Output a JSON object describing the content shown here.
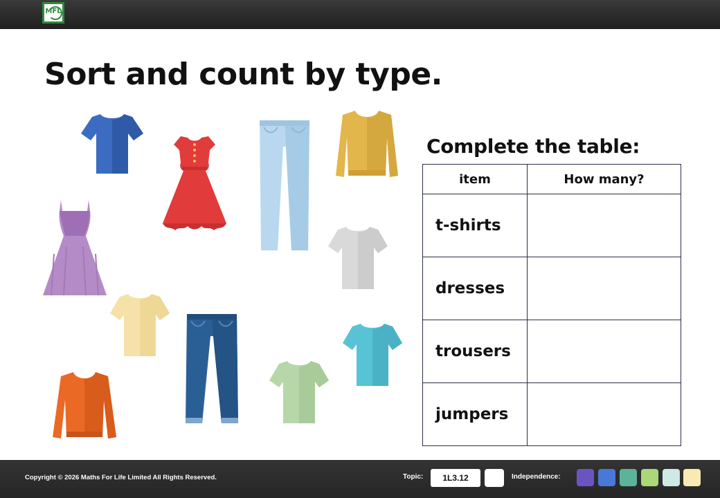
{
  "title": "Sort and count by type.",
  "subtitle": "Complete the table:",
  "table": {
    "headers": [
      "item",
      "How many?"
    ],
    "rows": [
      {
        "item": "t-shirts",
        "count": ""
      },
      {
        "item": "dresses",
        "count": ""
      },
      {
        "item": "trousers",
        "count": ""
      },
      {
        "item": "jumpers",
        "count": ""
      }
    ]
  },
  "logo": {
    "text": "MFL"
  },
  "garments": [
    {
      "type": "t-shirt",
      "color": "#3b6cc1"
    },
    {
      "type": "dress",
      "color": "#e23b3b"
    },
    {
      "type": "trousers",
      "color": "#b9d8ef"
    },
    {
      "type": "jumper",
      "color": "#e2b64a"
    },
    {
      "type": "dress",
      "color": "#b48bc6"
    },
    {
      "type": "t-shirt",
      "color": "#d9d9d9"
    },
    {
      "type": "t-shirt",
      "color": "#f6e2a8"
    },
    {
      "type": "trousers",
      "color": "#2a5f96"
    },
    {
      "type": "t-shirt",
      "color": "#59c3d6"
    },
    {
      "type": "jumper",
      "color": "#ea6a25"
    },
    {
      "type": "t-shirt",
      "color": "#b7d7a8"
    }
  ],
  "footer": {
    "copyright": "Copyright © 2026 Maths For Life Limited All Rights Reserved.",
    "topic_label": "Topic:",
    "topic_code": "1L3.12",
    "independence_label": "Independence:",
    "swatches": [
      "#6a54c2",
      "#4a78d8",
      "#5bb49a",
      "#a9d77a",
      "#cfe9e4",
      "#f9eab4"
    ]
  }
}
